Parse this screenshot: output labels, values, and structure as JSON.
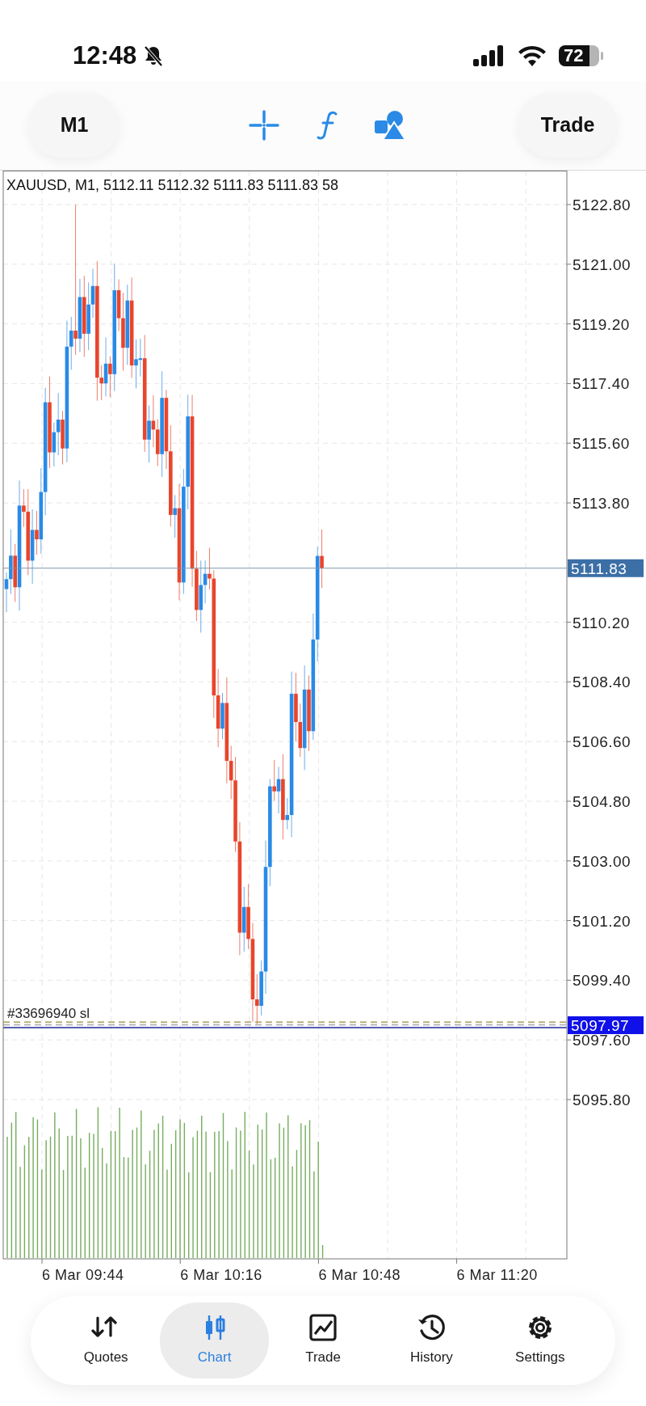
{
  "status_bar": {
    "time": "12:48",
    "battery": "72"
  },
  "toolbar": {
    "timeframe": "M1",
    "trade_button": "Trade"
  },
  "chart": {
    "header": "XAUUSD, M1, 5112.11 5112.32 5111.83 5111.83 58",
    "price_labels": [
      "5122.80",
      "5121.00",
      "5119.20",
      "5117.40",
      "5115.60",
      "5113.80",
      "5110.20",
      "5108.40",
      "5106.60",
      "5104.80",
      "5103.00",
      "5101.20",
      "5099.40",
      "5097.60",
      "5095.80"
    ],
    "time_labels": [
      "6 Mar 09:44",
      "6 Mar 10:16",
      "6 Mar 10:48",
      "6 Mar 11:20"
    ],
    "current_price": "5111.83",
    "order_price": "5097.97",
    "order_label": "#33696940 sl"
  },
  "tabs": [
    {
      "label": "Quotes",
      "kind": "quotes",
      "selected": false
    },
    {
      "label": "Chart",
      "kind": "chart",
      "selected": true
    },
    {
      "label": "Trade",
      "kind": "trade",
      "selected": false
    },
    {
      "label": "History",
      "kind": "history",
      "selected": false
    },
    {
      "label": "Settings",
      "kind": "settings",
      "selected": false
    }
  ]
}
